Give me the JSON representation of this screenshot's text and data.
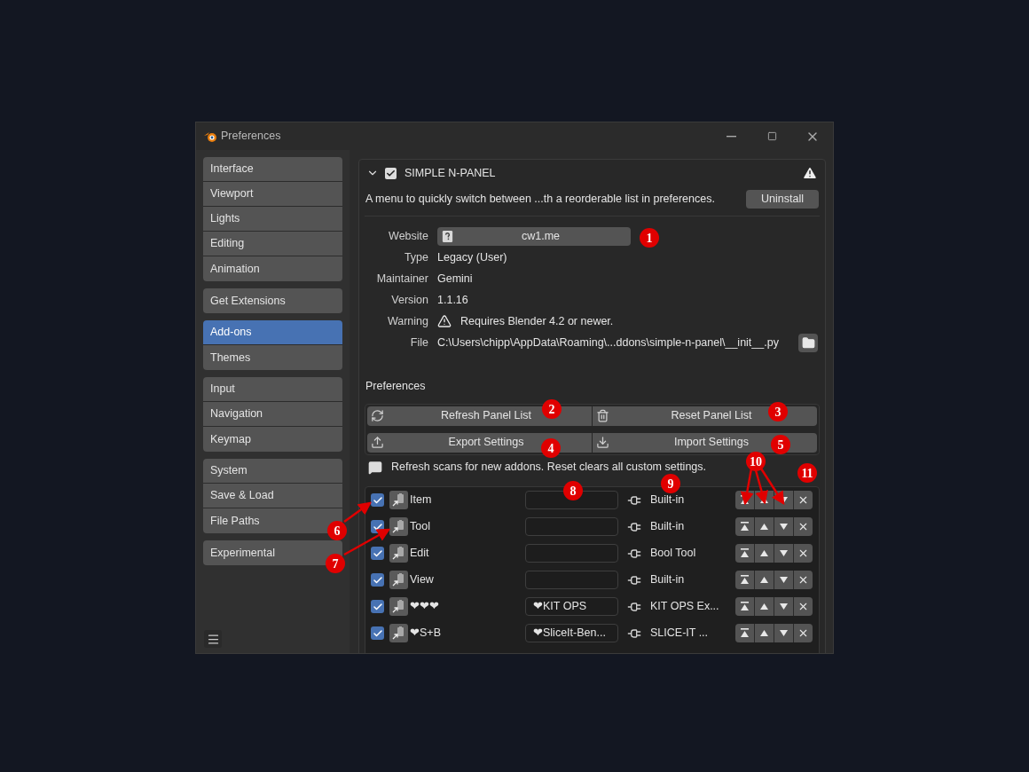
{
  "window": {
    "title": "Preferences"
  },
  "sidebar": {
    "groups": [
      [
        {
          "label": "Interface",
          "selected": false
        },
        {
          "label": "Viewport",
          "selected": false
        },
        {
          "label": "Lights",
          "selected": false
        },
        {
          "label": "Editing",
          "selected": false
        },
        {
          "label": "Animation",
          "selected": false
        }
      ],
      [
        {
          "label": "Get Extensions",
          "selected": false
        }
      ],
      [
        {
          "label": "Add-ons",
          "selected": true
        },
        {
          "label": "Themes",
          "selected": false
        }
      ],
      [
        {
          "label": "Input",
          "selected": false
        },
        {
          "label": "Navigation",
          "selected": false
        },
        {
          "label": "Keymap",
          "selected": false
        }
      ],
      [
        {
          "label": "System",
          "selected": false
        },
        {
          "label": "Save & Load",
          "selected": false
        },
        {
          "label": "File Paths",
          "selected": false
        }
      ],
      [
        {
          "label": "Experimental",
          "selected": false
        }
      ]
    ]
  },
  "addon": {
    "name": "SIMPLE N-PANEL",
    "enabled": true,
    "expanded": true,
    "description": "A menu to quickly switch between ...th a reorderable list in preferences.",
    "uninstall": "Uninstall",
    "details": [
      {
        "kind": "link",
        "label": "Website",
        "value": "cw1.me"
      },
      {
        "kind": "text",
        "label": "Type",
        "value": "Legacy (User)"
      },
      {
        "kind": "text",
        "label": "Maintainer",
        "value": "Gemini"
      },
      {
        "kind": "text",
        "label": "Version",
        "value": "1.1.16"
      },
      {
        "kind": "warning",
        "label": "Warning",
        "value": "Requires Blender 4.2 or newer."
      },
      {
        "kind": "file",
        "label": "File",
        "value": "C:\\Users\\chipp\\AppData\\Roaming\\...ddons\\simple-n-panel\\__init__.py"
      }
    ]
  },
  "preferences": {
    "title": "Preferences",
    "button_rows": [
      [
        {
          "kind": "refresh",
          "label": "Refresh Panel List"
        },
        {
          "kind": "reset",
          "label": "Reset Panel List"
        }
      ],
      [
        {
          "kind": "export",
          "label": "Export Settings"
        },
        {
          "kind": "import",
          "label": "Import Settings"
        }
      ]
    ],
    "info": "Refresh scans for new addons. Reset clears all custom settings.",
    "panels": [
      {
        "enabled": true,
        "name": "Item",
        "source": "Built-in"
      },
      {
        "enabled": true,
        "name": "Tool",
        "source": "Built-in"
      },
      {
        "enabled": true,
        "name": "Edit",
        "source": "Bool Tool"
      },
      {
        "enabled": true,
        "name": "View",
        "source": "Built-in"
      },
      {
        "enabled": true,
        "name": "❤❤❤",
        "category": "❤KIT OPS",
        "source": "KIT OPS Ex..."
      },
      {
        "enabled": true,
        "name": "❤S+B",
        "category": "❤SliceIt-Ben...",
        "source": "SLICE-IT ..."
      }
    ]
  },
  "annotations": [
    {
      "label": "1"
    },
    {
      "label": "2"
    },
    {
      "label": "3"
    },
    {
      "label": "4"
    },
    {
      "label": "5"
    },
    {
      "label": "6"
    },
    {
      "label": "7"
    },
    {
      "label": "8"
    },
    {
      "label": "9"
    },
    {
      "label": "10"
    },
    {
      "label": "11"
    }
  ]
}
